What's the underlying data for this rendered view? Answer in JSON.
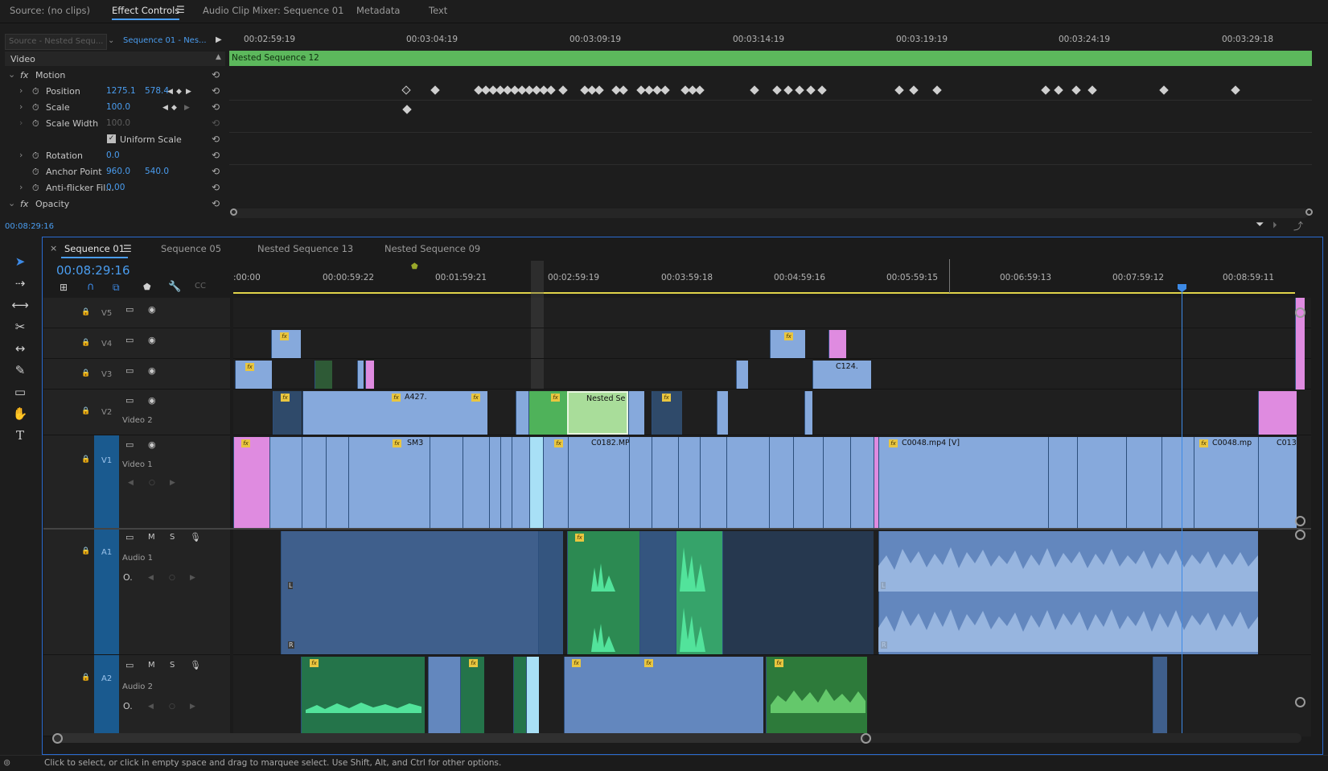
{
  "top_tabs": [
    "Source: (no clips)",
    "Effect Controls",
    "Audio Clip Mixer: Sequence 01",
    "Metadata",
    "Text"
  ],
  "effect_controls": {
    "source_dropdown": "Source - Nested Sequ...",
    "sequence_dropdown": "Sequence 01 - Nes...",
    "section": "Video",
    "clip_bar_label": "Nested Sequence 12",
    "ruler_labels": [
      "00:02:59:19",
      "00:03:04:19",
      "00:03:09:19",
      "00:03:14:19",
      "00:03:19:19",
      "00:03:24:19",
      "00:03:29:18"
    ],
    "motion_label": "Motion",
    "rows": {
      "position": {
        "label": "Position",
        "x": "1275.1",
        "y": "578.4"
      },
      "scale": {
        "label": "Scale",
        "value": "100.0"
      },
      "scale_width": {
        "label": "Scale Width",
        "value": "100.0"
      },
      "uniform_scale": "Uniform Scale",
      "rotation": {
        "label": "Rotation",
        "value": "0.0"
      },
      "anchor_point": {
        "label": "Anchor Point",
        "x": "960.0",
        "y": "540.0"
      },
      "anti_flicker": {
        "label": "Anti-flicker Fil...",
        "value": "0.00"
      },
      "opacity": "Opacity"
    },
    "current_time": "00:08:29:16"
  },
  "timeline": {
    "tabs": [
      "Sequence 01",
      "Sequence 05",
      "Nested Sequence 13",
      "Nested Sequence 09"
    ],
    "timecode": "00:08:29:16",
    "ruler_labels": [
      ":00:00",
      "00:00:59:22",
      "00:01:59:21",
      "00:02:59:19",
      "00:03:59:18",
      "00:04:59:16",
      "00:05:59:15",
      "00:06:59:13",
      "00:07:59:12",
      "00:08:59:11"
    ],
    "tracks": {
      "v5": "V5",
      "v4": "V4",
      "v3": "V3",
      "v2": "V2",
      "v2_name": "Video 2",
      "v1": "V1",
      "v1_name": "Video 1",
      "a1": "A1",
      "a1_name": "Audio 1",
      "a2": "A2",
      "a2_name": "Audio 2",
      "m": "M",
      "s": "S"
    },
    "clip_labels": {
      "a427": "A427.",
      "nested": "Nested Se",
      "c124": "C124.",
      "sm3": "SM3",
      "c0182": "C0182.MP",
      "c0048v": "C0048.mp4 [V]",
      "c0048": "C0048.mp",
      "c013": "C013"
    },
    "fx_label": "fx",
    "audio_L": "L",
    "audio_R": "R"
  },
  "status_bar": "Click to select, or click in empty space and drag to marquee select. Use Shift, Alt, and Ctrl for other options.",
  "colors": {
    "accent": "#4a9df0",
    "video_clip": "#86a9dc",
    "green_clip": "#4fb25a",
    "pink_clip": "#df8be0",
    "audio_clip": "#6387be",
    "playhead": "#4a9df0"
  }
}
